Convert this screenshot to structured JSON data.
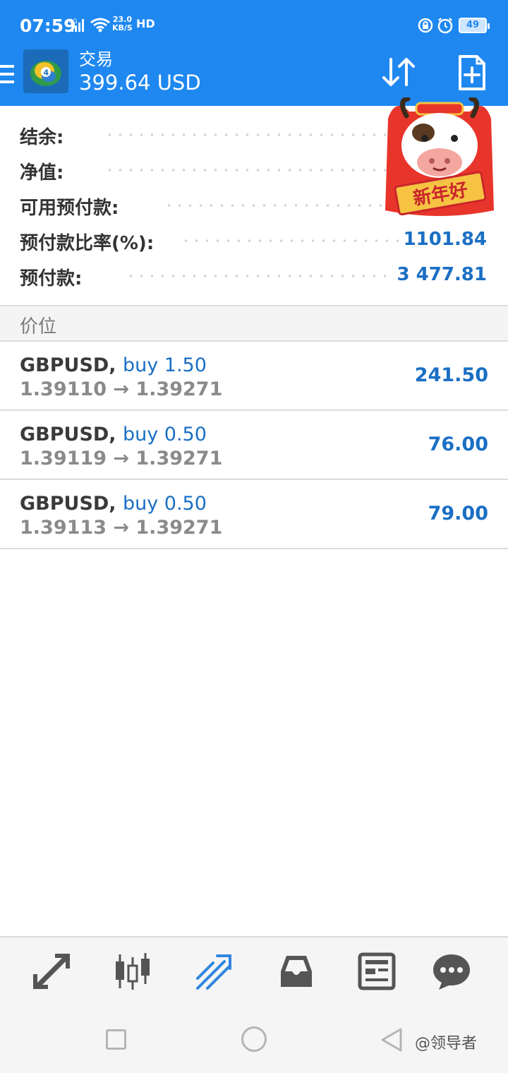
{
  "status_bar": {
    "time": "07:59",
    "network": "4G",
    "speed_value": "23.0",
    "speed_unit": "KB/S",
    "hd": "HD",
    "battery": "49"
  },
  "app_bar": {
    "title": "交易",
    "balance": "399.64 USD",
    "accent_color": "#1e88f0"
  },
  "summary": {
    "rows": [
      {
        "label": "结余:",
        "value": ""
      },
      {
        "label": "净值:",
        "value": ""
      },
      {
        "label": "可用预付款:",
        "value": ""
      },
      {
        "label": "预付款比率(%):",
        "value": "1101.84"
      },
      {
        "label": "预付款:",
        "value": "3 477.81"
      }
    ]
  },
  "sticker": {
    "text": "新年好"
  },
  "positions": {
    "title": "价位",
    "items": [
      {
        "symbol": "GBPUSD,",
        "side": "buy 1.50",
        "prices": "1.39110 → 1.39271",
        "profit": "241.50"
      },
      {
        "symbol": "GBPUSD,",
        "side": "buy 0.50",
        "prices": "1.39119 → 1.39271",
        "profit": "76.00"
      },
      {
        "symbol": "GBPUSD,",
        "side": "buy 0.50",
        "prices": "1.39113 → 1.39271",
        "profit": "79.00"
      }
    ]
  },
  "tab_bar": {
    "tabs": [
      {
        "icon": "quotes-arrows-icon",
        "active": false
      },
      {
        "icon": "candlestick-chart-icon",
        "active": false
      },
      {
        "icon": "trade-trend-icon",
        "active": true
      },
      {
        "icon": "inbox-icon",
        "active": false
      },
      {
        "icon": "news-icon",
        "active": false
      },
      {
        "icon": "chat-icon",
        "active": false
      }
    ]
  },
  "watermark": "@领导者"
}
